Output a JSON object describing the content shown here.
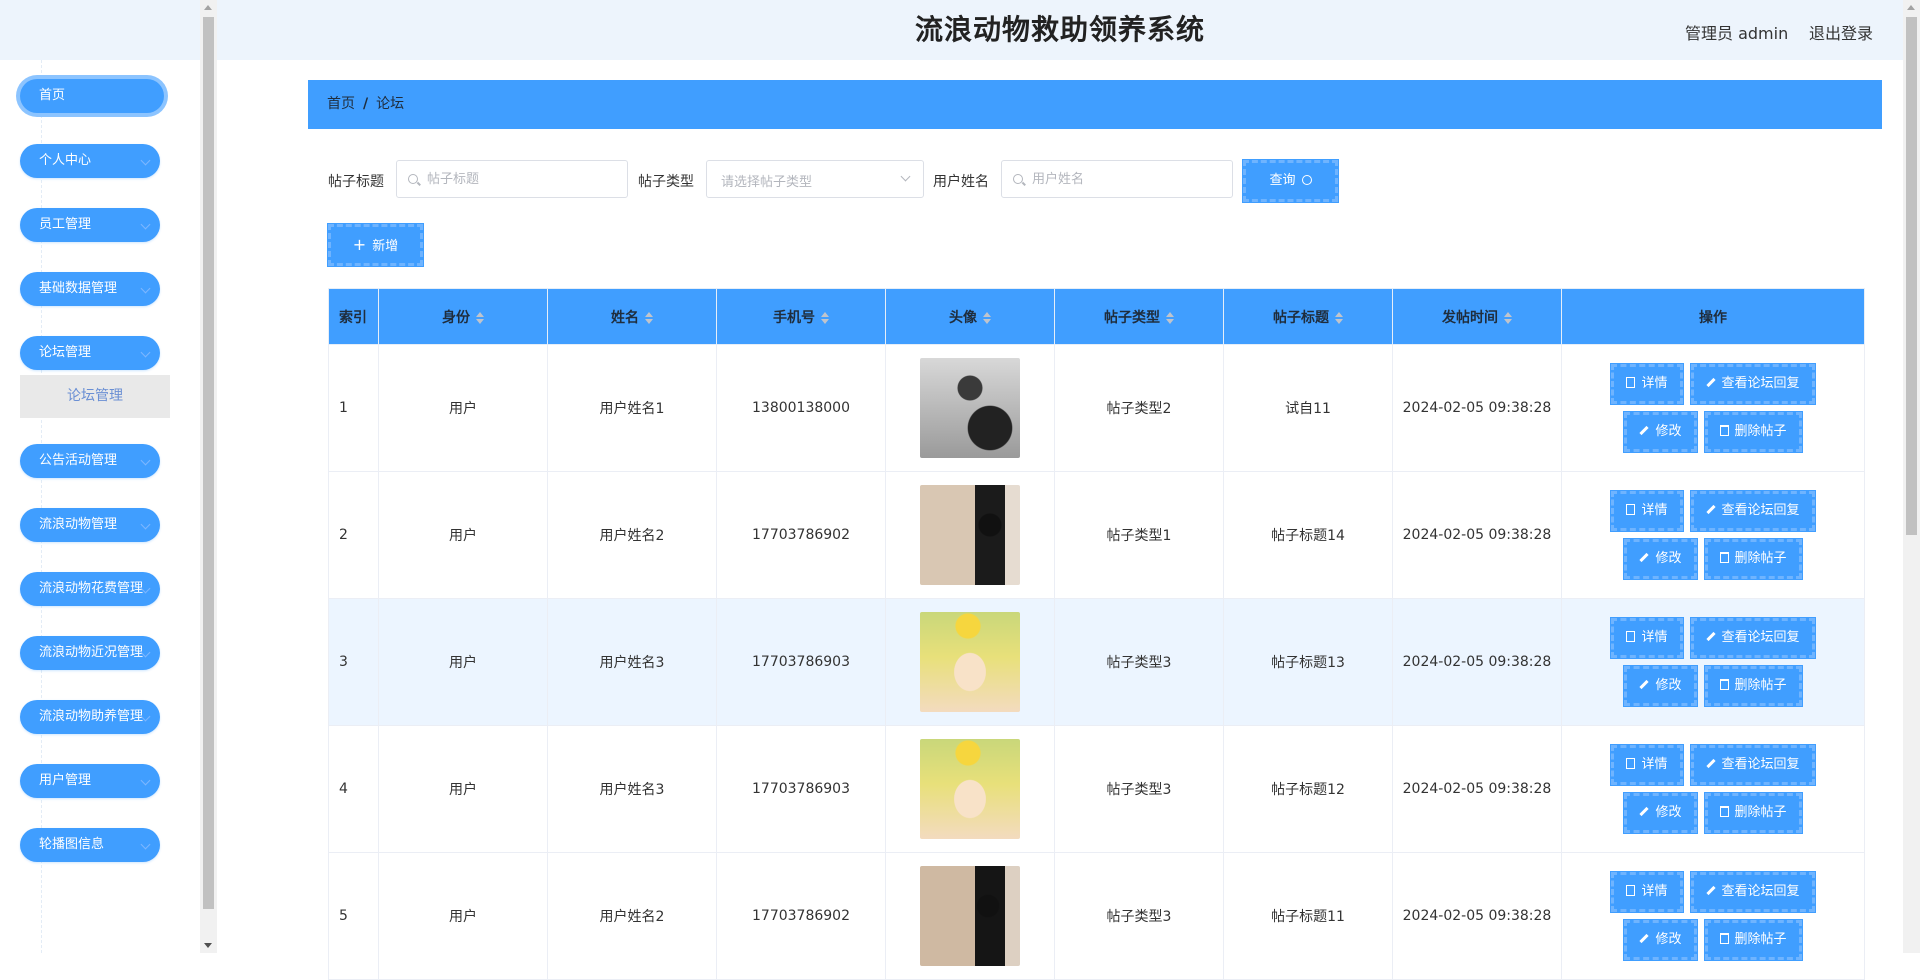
{
  "header": {
    "title": "流浪动物救助领养系统",
    "admin": "管理员 admin",
    "logout": "退出登录"
  },
  "sidebar": {
    "items": [
      {
        "label": "首页",
        "active": true,
        "has_children": false
      },
      {
        "label": "个人中心",
        "has_children": true
      },
      {
        "label": "员工管理",
        "has_children": true
      },
      {
        "label": "基础数据管理",
        "has_children": true
      },
      {
        "label": "论坛管理",
        "has_children": true
      },
      {
        "label": "公告活动管理",
        "has_children": true
      },
      {
        "label": "流浪动物管理",
        "has_children": true
      },
      {
        "label": "流浪动物花费管理",
        "has_children": true
      },
      {
        "label": "流浪动物近况管理",
        "has_children": true
      },
      {
        "label": "流浪动物助养管理",
        "has_children": true
      },
      {
        "label": "用户管理",
        "has_children": true
      },
      {
        "label": "轮播图信息",
        "has_children": true
      }
    ],
    "open_submenu": {
      "label": "论坛管理"
    }
  },
  "breadcrumb": {
    "home": "首页",
    "separator": "/",
    "current": "论坛"
  },
  "filters": {
    "title_label": "帖子标题",
    "title_placeholder": "帖子标题",
    "type_label": "帖子类型",
    "type_placeholder": "请选择帖子类型",
    "username_label": "用户姓名",
    "username_placeholder": "用户姓名",
    "query_button": "查询"
  },
  "toolbar": {
    "add_button": "新增"
  },
  "table": {
    "columns": [
      "索引",
      "身份",
      "姓名",
      "手机号",
      "头像",
      "帖子类型",
      "帖子标题",
      "发帖时间",
      "操作"
    ],
    "actions": {
      "detail": "详情",
      "view_replies": "查看论坛回复",
      "edit": "修改",
      "delete": "删除帖子"
    },
    "rows": [
      {
        "index": "1",
        "role": "用户",
        "name": "用户姓名1",
        "phone": "13800138000",
        "avatar": "avatar-photo",
        "type": "帖子类型2",
        "title": "试自11",
        "time": "2024-02-05 09:38:28"
      },
      {
        "index": "2",
        "role": "用户",
        "name": "用户姓名2",
        "phone": "17703786902",
        "avatar": "avatar-photo",
        "type": "帖子类型1",
        "title": "帖子标题14",
        "time": "2024-02-05 09:38:28"
      },
      {
        "index": "3",
        "role": "用户",
        "name": "用户姓名3",
        "phone": "17703786903",
        "avatar": "avatar-photo",
        "type": "帖子类型3",
        "title": "帖子标题13",
        "time": "2024-02-05 09:38:28"
      },
      {
        "index": "4",
        "role": "用户",
        "name": "用户姓名3",
        "phone": "17703786903",
        "avatar": "avatar-photo",
        "type": "帖子类型3",
        "title": "帖子标题12",
        "time": "2024-02-05 09:38:28"
      },
      {
        "index": "5",
        "role": "用户",
        "name": "用户姓名2",
        "phone": "17703786902",
        "avatar": "avatar-photo",
        "type": "帖子类型3",
        "title": "帖子标题11",
        "time": "2024-02-05 09:38:28"
      }
    ]
  },
  "colors": {
    "accent": "#409eff",
    "header_bg": "#edf4fc",
    "row_highlight": "#ecf5ff"
  }
}
